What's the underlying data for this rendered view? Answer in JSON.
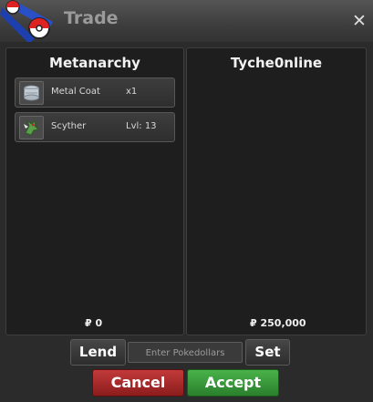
{
  "window": {
    "title": "Trade",
    "close_glyph": "✕"
  },
  "left": {
    "name": "Metanarchy",
    "items": [
      {
        "icon": "metal-coat-icon",
        "name": "Metal Coat",
        "qty": "x1"
      },
      {
        "icon": "scyther-icon",
        "name": "Scyther",
        "qty": "Lvl: 13"
      }
    ],
    "money": "₽ 0"
  },
  "right": {
    "name": "Tyche0nline",
    "money": "₽ 250,000"
  },
  "controls": {
    "lend_label": "Lend",
    "pokedollars_placeholder": "Enter Pokedollars",
    "set_label": "Set",
    "cancel_label": "Cancel",
    "accept_label": "Accept"
  },
  "colors": {
    "cancel": "#a82a2a",
    "accept": "#3a9a3b"
  }
}
